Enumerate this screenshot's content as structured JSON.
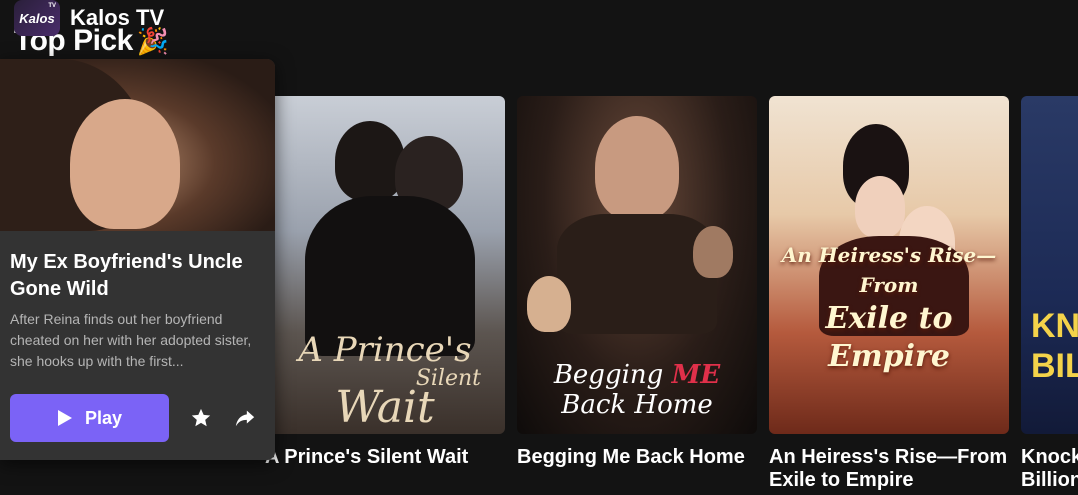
{
  "brand": {
    "logo_text": "Kalos",
    "logo_badge": "TV",
    "name": "Kalos TV"
  },
  "section": {
    "title": "Top Pick",
    "emoji": "🎉"
  },
  "featured": {
    "title": "My Ex Boyfriend's Uncle Gone Wild",
    "description": "After Reina finds out her boyfriend cheated on her with her adopted sister, she hooks up with the first...",
    "play_label": "Play",
    "icons": {
      "favorite": "star-icon",
      "share": "share-icon",
      "play": "play-icon"
    },
    "accent_color": "#7b63f6"
  },
  "cards": [
    {
      "title": "A Prince's Silent Wait",
      "poster_text": [
        "A Prince's",
        "Silent",
        "Wait"
      ]
    },
    {
      "title": "Begging Me Back Home",
      "poster_text": [
        "Begging ",
        "ME",
        "Back Home"
      ]
    },
    {
      "title": "An Heiress's Rise—From Exile to Empire",
      "poster_text": [
        "An Heiress's Rise—From",
        "Exile to Empire"
      ]
    },
    {
      "title": "Knock",
      "subtitle": "Billion",
      "poster_text": [
        "KNO",
        "BILL"
      ]
    }
  ]
}
